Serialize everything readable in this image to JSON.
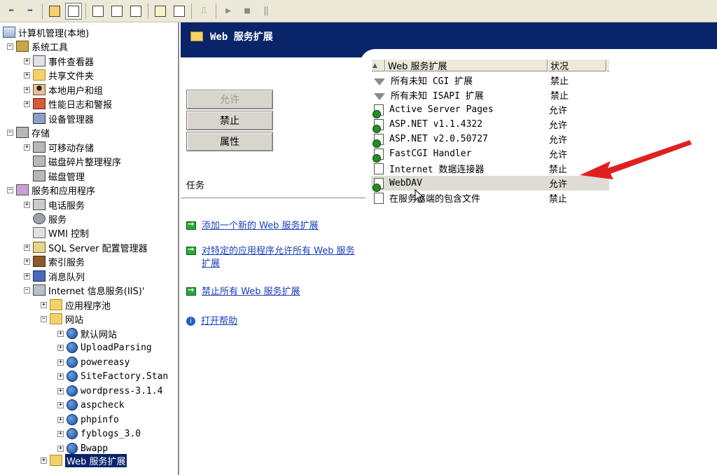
{
  "toolbar": {
    "buttons": [
      "back-icon",
      "forward-icon",
      "up-folder-icon",
      "show-tree-icon",
      "properties-icon",
      "export-icon",
      "refresh-icon",
      "help-icon",
      "view-icon",
      "connect-icon",
      "play-icon",
      "stop-icon",
      "pause-icon"
    ]
  },
  "tree": {
    "root": "计算机管理(本地)",
    "system_tools": "系统工具",
    "event_viewer": "事件查看器",
    "shared_folders": "共享文件夹",
    "local_users": "本地用户和组",
    "perf_logs": "性能日志和警报",
    "device_manager": "设备管理器",
    "storage": "存储",
    "removable_storage": "可移动存储",
    "defrag": "磁盘碎片整理程序",
    "disk_mgmt": "磁盘管理",
    "services_apps": "服务和应用程序",
    "telephony": "电话服务",
    "services": "服务",
    "wmi": "WMI 控制",
    "sql_config": "SQL Server 配置管理器",
    "indexing": "索引服务",
    "message_queue": "消息队列",
    "iis": "Internet 信息服务(IIS)'",
    "app_pools": "应用程序池",
    "websites": "网站",
    "sites": [
      "默认网站",
      "UploadParsing",
      "powereasy",
      "SiteFactory.Stan",
      "wordpress-3.1.4",
      "aspcheck",
      "phpinfo",
      "fyblogs_3.0",
      "Bwapp"
    ],
    "web_ext": "Web 服务扩展"
  },
  "header": {
    "title": "Web 服务扩展"
  },
  "actions": {
    "allow": "允许",
    "prohibit": "禁止",
    "properties": "属性"
  },
  "tasks": {
    "label": "任务",
    "items": [
      "添加一个新的 Web 服务扩展",
      "对特定的应用程序允许所有 Web 服务扩展",
      "禁止所有 Web 服务扩展"
    ],
    "help": "打开帮助"
  },
  "list": {
    "columns": {
      "name": "Web 服务扩展",
      "status": "状况"
    },
    "rows": [
      {
        "name": "所有未知 CGI 扩展",
        "status": "禁止",
        "icon": "funnel-icon"
      },
      {
        "name": "所有未知 ISAPI 扩展",
        "status": "禁止",
        "icon": "funnel-icon"
      },
      {
        "name": "Active Server Pages",
        "status": "允许",
        "icon": "allowed-page-icon"
      },
      {
        "name": "ASP.NET v1.1.4322",
        "status": "允许",
        "icon": "allowed-page-icon"
      },
      {
        "name": "ASP.NET v2.0.50727",
        "status": "允许",
        "icon": "allowed-page-icon"
      },
      {
        "name": "FastCGI Handler",
        "status": "允许",
        "icon": "allowed-page-icon"
      },
      {
        "name": "Internet 数据连接器",
        "status": "禁止",
        "icon": "page-icon"
      },
      {
        "name": "WebDAV",
        "status": "允许",
        "icon": "allowed-page-icon"
      },
      {
        "name": "在服务器端的包含文件",
        "status": "禁止",
        "icon": "page-icon"
      }
    ]
  },
  "colors": {
    "title_band": "#0a246a",
    "link": "#1a3fb8",
    "annotation_arrow": "#e02020"
  }
}
